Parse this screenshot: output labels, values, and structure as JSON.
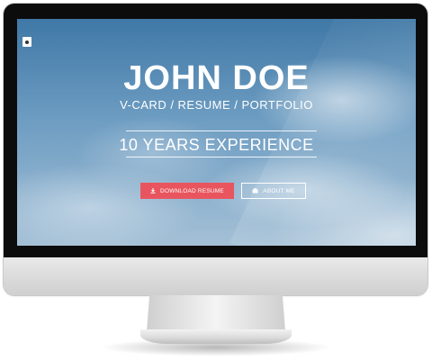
{
  "hero": {
    "name": "JOHN DOE",
    "subtitle": "V-CARD / RESUME / PORTFOLIO",
    "experience": "10 YEARS EXPERIENCE"
  },
  "buttons": {
    "download": {
      "label": "DOWNLOAD RESUME",
      "icon": "download-icon"
    },
    "about": {
      "label": "ABOUT ME",
      "icon": "briefcase-icon"
    }
  },
  "menu": {
    "icon": "menu-toggle-icon"
  },
  "colors": {
    "accent": "#e9555e",
    "bezel": "#0c0c0c",
    "sky": "#5b8db8"
  }
}
